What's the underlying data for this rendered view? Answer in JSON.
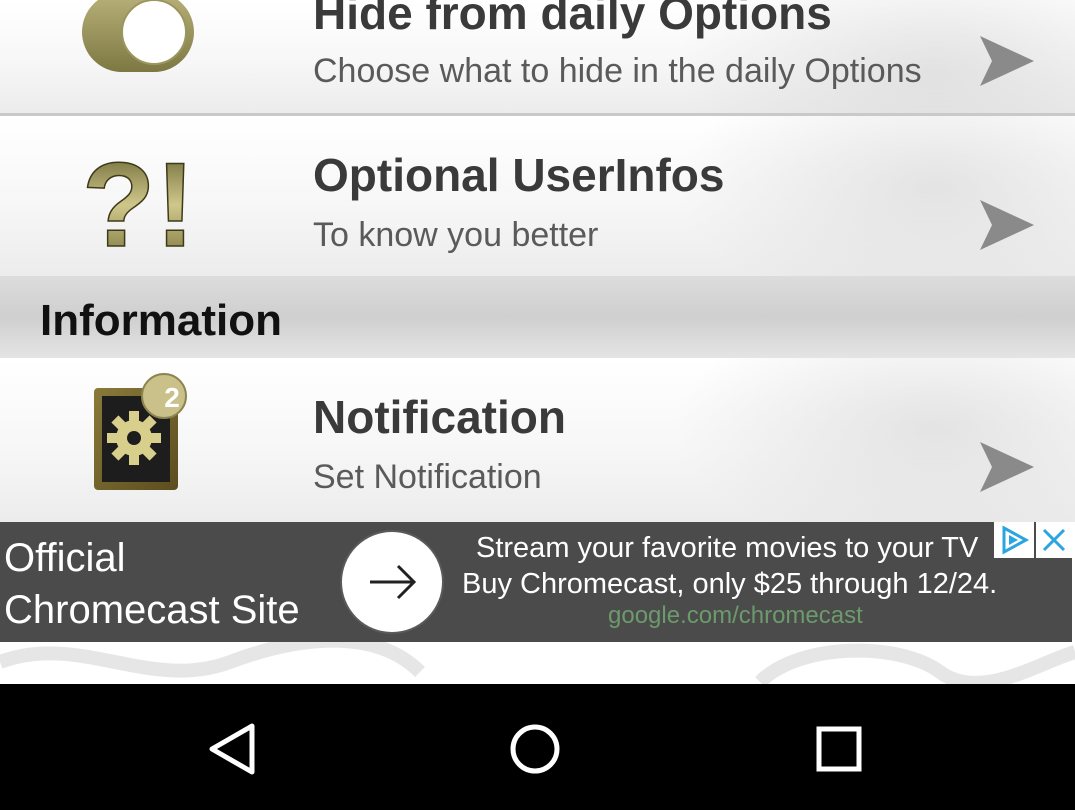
{
  "rows": [
    {
      "title": "Hide from daily Options",
      "subtitle": "Choose what to hide in the daily Options",
      "icon": "toggle-icon"
    },
    {
      "title": "Optional UserInfos",
      "subtitle": "To know you better",
      "icon": "question-exclamation-icon"
    },
    {
      "title": "Notification",
      "subtitle": "Set Notification",
      "icon": "notification-gear-icon",
      "badge": "2"
    }
  ],
  "section": {
    "label": "Information"
  },
  "ad": {
    "title": "Official Chromecast Site",
    "line1": "Stream your favorite movies to your TV",
    "line2": "Buy Chromecast, only $25 through 12/24.",
    "url": "google.com/chromecast",
    "icons": [
      "arrow-right-icon",
      "adchoices-icon",
      "close-icon"
    ]
  },
  "navbar": {
    "buttons": [
      "back-icon",
      "home-icon",
      "recents-icon"
    ]
  },
  "colors": {
    "accent_olive": "#8f8a4a",
    "ad_background": "#4b4b4b",
    "ad_url": "#6c9a6c",
    "adchoices_blue": "#2aa5e0",
    "navbar": "#000000"
  }
}
